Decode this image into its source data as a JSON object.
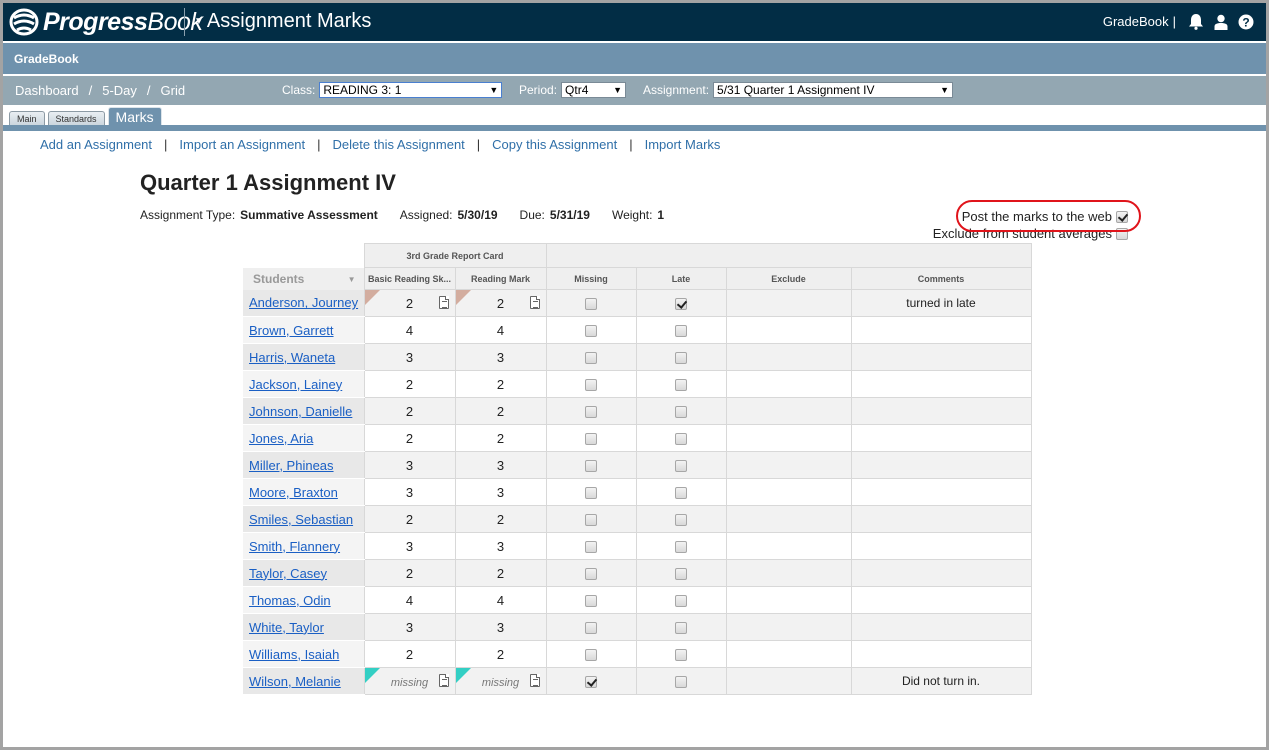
{
  "header": {
    "logo_bold": "Progress",
    "logo_light": "Book",
    "app_title": "Assignment Marks",
    "module_link": "GradeBook",
    "separator": "|",
    "icons": [
      "bell-icon",
      "user-icon",
      "help-icon"
    ]
  },
  "module_bar": {
    "title": "GradeBook"
  },
  "breadcrumb": [
    {
      "label": "Dashboard"
    },
    {
      "label": "5-Day"
    },
    {
      "label": "Grid"
    }
  ],
  "breadcrumb_separator": "/",
  "filters": {
    "class": {
      "label": "Class:",
      "value": "READING 3: 1"
    },
    "period": {
      "label": "Period:",
      "value": "Qtr4"
    },
    "assignment": {
      "label": "Assignment:",
      "value": "5/31 Quarter 1 Assignment IV"
    }
  },
  "tabs": [
    {
      "label": "Main",
      "active": false
    },
    {
      "label": "Standards",
      "active": false
    },
    {
      "label": "Marks",
      "active": true
    }
  ],
  "actions": [
    "Add an Assignment",
    "Import an Assignment",
    "Delete this Assignment",
    "Copy this Assignment",
    "Import Marks"
  ],
  "action_separator": "|",
  "assignment": {
    "title": "Quarter 1 Assignment IV",
    "type_label": "Assignment Type:",
    "type_value": "Summative Assessment",
    "assigned_label": "Assigned:",
    "assigned_value": "5/30/19",
    "due_label": "Due:",
    "due_value": "5/31/19",
    "weight_label": "Weight:",
    "weight_value": "1"
  },
  "options": {
    "post_to_web": {
      "label": "Post the marks to the web",
      "checked": true
    },
    "exclude_averages": {
      "label": "Exclude from student averages",
      "checked": false
    }
  },
  "grid": {
    "group_header": "3rd Grade Report Card",
    "students_header": "Students",
    "sort_icon": "▼",
    "columns": [
      "Basic Reading Sk...",
      "Reading Mark",
      "Missing",
      "Late",
      "Exclude",
      "Comments"
    ],
    "rows": [
      {
        "name": "Anderson, Journey",
        "basic": "2",
        "reading": "2",
        "flag": "tan",
        "note": true,
        "missing": false,
        "late": true,
        "comment": "turned in late"
      },
      {
        "name": "Brown, Garrett",
        "basic": "4",
        "reading": "4",
        "flag": "",
        "note": false,
        "missing": false,
        "late": false,
        "comment": ""
      },
      {
        "name": "Harris, Waneta",
        "basic": "3",
        "reading": "3",
        "flag": "",
        "note": false,
        "missing": false,
        "late": false,
        "comment": ""
      },
      {
        "name": "Jackson, Lainey",
        "basic": "2",
        "reading": "2",
        "flag": "",
        "note": false,
        "missing": false,
        "late": false,
        "comment": ""
      },
      {
        "name": "Johnson, Danielle",
        "basic": "2",
        "reading": "2",
        "flag": "",
        "note": false,
        "missing": false,
        "late": false,
        "comment": ""
      },
      {
        "name": "Jones, Aria",
        "basic": "2",
        "reading": "2",
        "flag": "",
        "note": false,
        "missing": false,
        "late": false,
        "comment": ""
      },
      {
        "name": "Miller, Phineas",
        "basic": "3",
        "reading": "3",
        "flag": "",
        "note": false,
        "missing": false,
        "late": false,
        "comment": ""
      },
      {
        "name": "Moore, Braxton",
        "basic": "3",
        "reading": "3",
        "flag": "",
        "note": false,
        "missing": false,
        "late": false,
        "comment": ""
      },
      {
        "name": "Smiles, Sebastian",
        "basic": "2",
        "reading": "2",
        "flag": "",
        "note": false,
        "missing": false,
        "late": false,
        "comment": ""
      },
      {
        "name": "Smith, Flannery",
        "basic": "3",
        "reading": "3",
        "flag": "",
        "note": false,
        "missing": false,
        "late": false,
        "comment": ""
      },
      {
        "name": "Taylor, Casey",
        "basic": "2",
        "reading": "2",
        "flag": "",
        "note": false,
        "missing": false,
        "late": false,
        "comment": ""
      },
      {
        "name": "Thomas, Odin",
        "basic": "4",
        "reading": "4",
        "flag": "",
        "note": false,
        "missing": false,
        "late": false,
        "comment": ""
      },
      {
        "name": "White, Taylor",
        "basic": "3",
        "reading": "3",
        "flag": "",
        "note": false,
        "missing": false,
        "late": false,
        "comment": ""
      },
      {
        "name": "Williams, Isaiah",
        "basic": "2",
        "reading": "2",
        "flag": "",
        "note": false,
        "missing": false,
        "late": false,
        "comment": ""
      },
      {
        "name": "Wilson, Melanie",
        "basic": "missing",
        "reading": "missing",
        "flag": "teal",
        "note": true,
        "missing": true,
        "late": false,
        "comment": "Did not turn in."
      }
    ]
  },
  "colors": {
    "topbar": "#022d45",
    "module_bar": "#6f92ad",
    "filter_bar": "#93a7b2",
    "link": "#2f6fa8",
    "student_link": "#1a5fc4",
    "highlight_ring": "#e0141b",
    "flag_tan": "#d3ad9f",
    "flag_teal": "#33cfc4"
  }
}
